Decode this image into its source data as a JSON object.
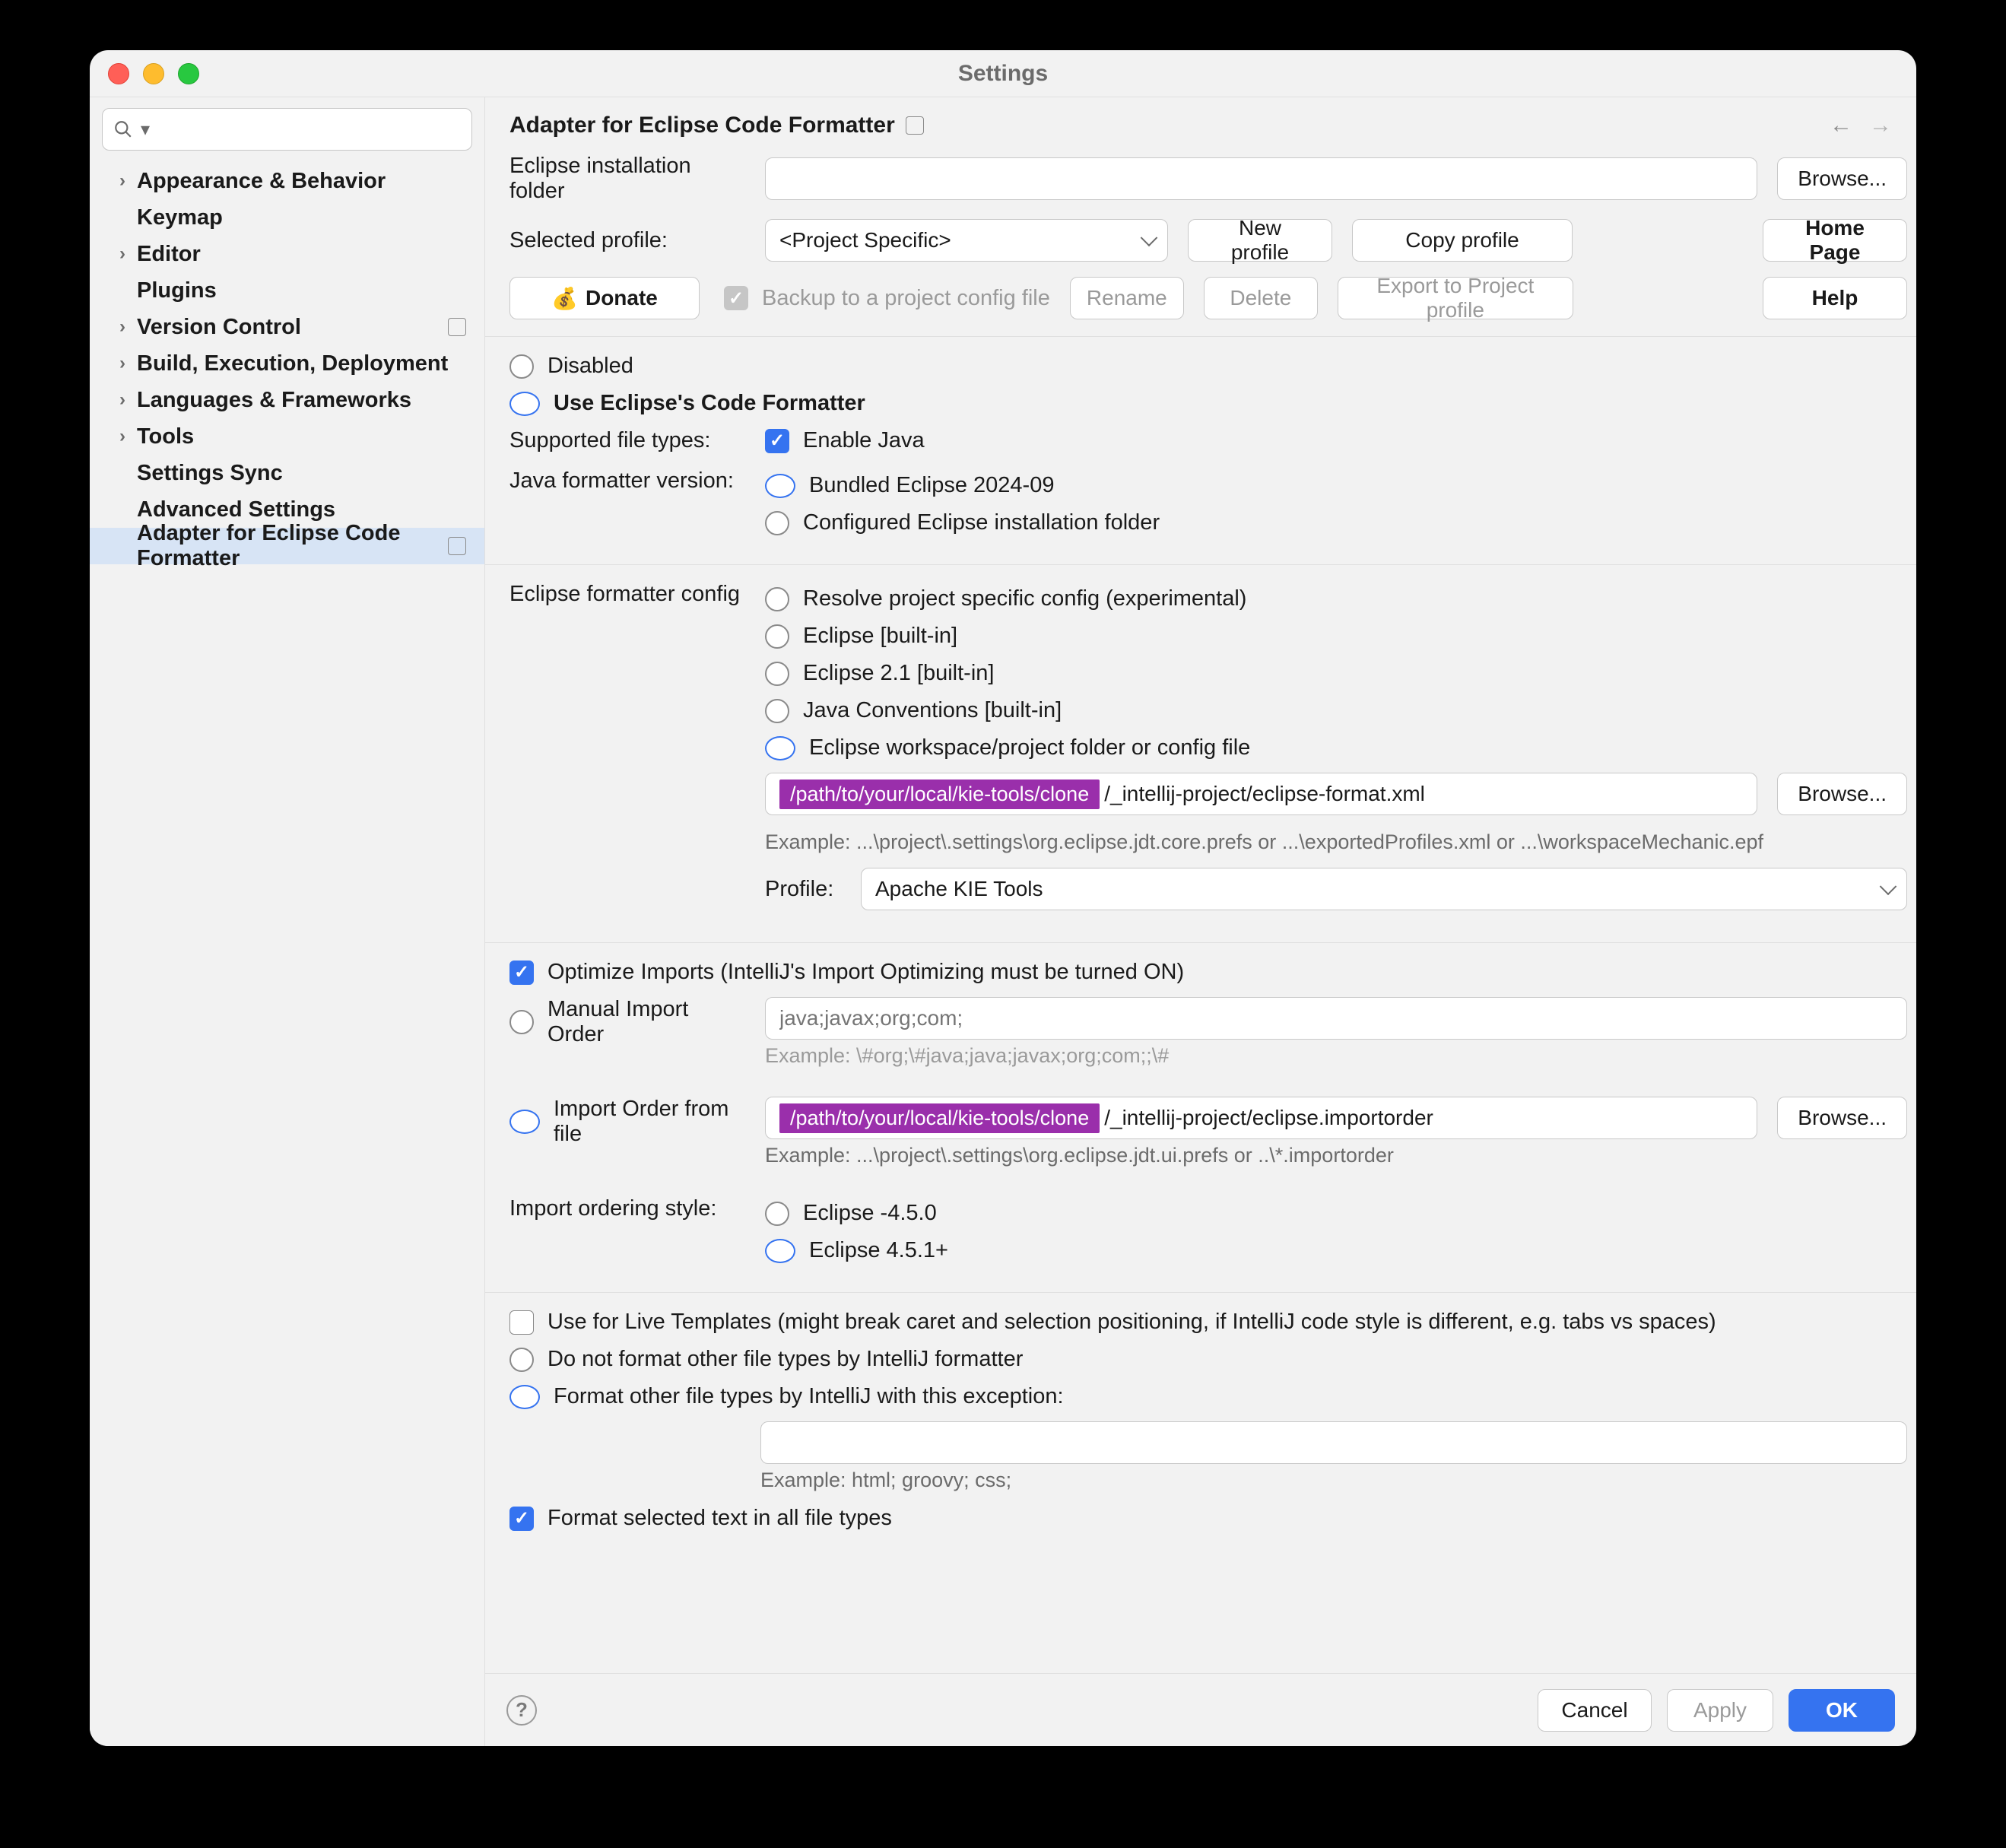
{
  "title": "Settings",
  "search_placeholder": "",
  "sidebar": {
    "items": [
      {
        "label": "Appearance & Behavior",
        "chev": true
      },
      {
        "label": "Keymap",
        "chev": false,
        "indent": true
      },
      {
        "label": "Editor",
        "chev": true
      },
      {
        "label": "Plugins",
        "chev": false,
        "indent": true
      },
      {
        "label": "Version Control",
        "chev": true,
        "trail": true
      },
      {
        "label": "Build, Execution, Deployment",
        "chev": true
      },
      {
        "label": "Languages & Frameworks",
        "chev": true
      },
      {
        "label": "Tools",
        "chev": true
      },
      {
        "label": "Settings Sync",
        "chev": false,
        "indent": true
      },
      {
        "label": "Advanced Settings",
        "chev": false,
        "indent": true
      },
      {
        "label": "Adapter for Eclipse Code Formatter",
        "chev": false,
        "indent": true,
        "selected": true,
        "trail": true
      }
    ]
  },
  "header": {
    "title": "Adapter for Eclipse Code Formatter"
  },
  "install_folder": {
    "label": "Eclipse installation folder",
    "value": "",
    "browse": "Browse..."
  },
  "profile_row": {
    "label": "Selected profile:",
    "value": "<Project Specific>",
    "new": "New profile",
    "copy": "Copy profile",
    "home": "Home Page"
  },
  "action_row": {
    "donate": "Donate",
    "backup": "Backup to a project config file",
    "rename": "Rename",
    "delete": "Delete",
    "export": "Export to Project profile",
    "help": "Help"
  },
  "mode": {
    "disabled": "Disabled",
    "use": "Use Eclipse's Code Formatter"
  },
  "supported": {
    "label": "Supported file types:",
    "enable_java": "Enable Java"
  },
  "jfv": {
    "label": "Java formatter version:",
    "bundled": "Bundled Eclipse 2024-09",
    "configured": "Configured Eclipse installation folder"
  },
  "efc": {
    "label": "Eclipse formatter config",
    "opts": {
      "resolve": "Resolve project specific config (experimental)",
      "ebi": "Eclipse [built-in]",
      "e21": "Eclipse 2.1 [built-in]",
      "conv": "Java Conventions [built-in]",
      "ws": "Eclipse workspace/project folder or config file"
    },
    "path_hl": "/path/to/your/local/kie-tools/clone",
    "path_rest": "/_intellij-project/eclipse-format.xml",
    "browse": "Browse...",
    "example": "Example: ...\\project\\.settings\\org.eclipse.jdt.core.prefs or ...\\exportedProfiles.xml or ...\\workspaceMechanic.epf",
    "profile_label": "Profile:",
    "profile_value": "Apache KIE Tools"
  },
  "optimize": "Optimize Imports  (IntelliJ's Import Optimizing must be turned ON)",
  "manual": {
    "label": "Manual Import Order",
    "placeholder": "java;javax;org;com;",
    "example": "Example: \\#org;\\#java;java;javax;org;com;;\\#"
  },
  "from_file": {
    "label": "Import Order from file",
    "path_hl": "/path/to/your/local/kie-tools/clone",
    "path_rest": "/_intellij-project/eclipse.importorder",
    "browse": "Browse...",
    "example": "Example: ...\\project\\.settings\\org.eclipse.jdt.ui.prefs or ..\\*.importorder"
  },
  "ordering": {
    "label": "Import ordering style:",
    "a": "Eclipse -4.5.0",
    "b": "Eclipse 4.5.1+"
  },
  "live": "Use for Live Templates (might break caret and selection positioning, if IntelliJ code style is different, e.g. tabs vs spaces)",
  "nofmt": "Do not format other file types by IntelliJ formatter",
  "fmt_except": {
    "label": "Format other file types by IntelliJ with this exception:",
    "value": "",
    "example": "Example: html; groovy; css;"
  },
  "sel_text": "Format selected text in all file types",
  "footer": {
    "cancel": "Cancel",
    "apply": "Apply",
    "ok": "OK"
  }
}
